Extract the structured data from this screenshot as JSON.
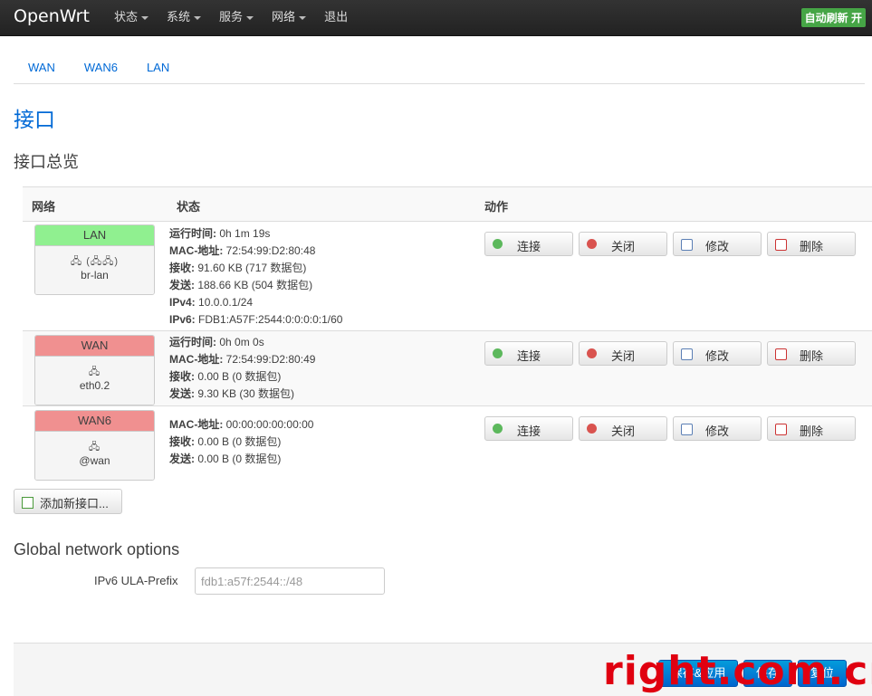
{
  "brand": "OpenWrt",
  "menu": [
    "状态",
    "系统",
    "服务",
    "网络",
    "退出"
  ],
  "menu_has_caret": [
    true,
    true,
    true,
    true,
    false
  ],
  "autorefresh": "自动刷新 开",
  "tabs": [
    "WAN",
    "WAN6",
    "LAN"
  ],
  "page_title": "接口",
  "section_title": "接口总览",
  "table": {
    "col_network": "网络",
    "col_status": "状态",
    "col_actions": "动作"
  },
  "actions": {
    "connect": "连接",
    "stop": "关闭",
    "edit": "修改",
    "delete": "删除"
  },
  "interfaces": [
    {
      "name": "LAN",
      "color": "#90f090",
      "icons": "🖧 (🖧🖧)",
      "device": "br-lan",
      "status": [
        {
          "k": "运行时间:",
          "v": " 0h 1m 19s"
        },
        {
          "k": "MAC-地址:",
          "v": " 72:54:99:D2:80:48"
        },
        {
          "k": "接收:",
          "v": " 91.60 KB (717 数据包)"
        },
        {
          "k": "发送:",
          "v": " 188.66 KB (504 数据包)"
        },
        {
          "k": "IPv4:",
          "v": " 10.0.0.1/24"
        },
        {
          "k": "IPv6:",
          "v": " FDB1:A57F:2544:0:0:0:0:1/60"
        }
      ]
    },
    {
      "name": "WAN",
      "color": "#f09090",
      "icons": "🖧",
      "device": "eth0.2",
      "status": [
        {
          "k": "运行时间:",
          "v": " 0h 0m 0s"
        },
        {
          "k": "MAC-地址:",
          "v": " 72:54:99:D2:80:49"
        },
        {
          "k": "接收:",
          "v": " 0.00 B (0 数据包)"
        },
        {
          "k": "发送:",
          "v": " 9.30 KB (30 数据包)"
        }
      ]
    },
    {
      "name": "WAN6",
      "color": "#f09090",
      "icons": "🖧",
      "device": "@wan",
      "status": [
        {
          "k": "MAC-地址:",
          "v": " 00:00:00:00:00:00"
        },
        {
          "k": "接收:",
          "v": " 0.00 B (0 数据包)"
        },
        {
          "k": "发送:",
          "v": " 0.00 B (0 数据包)"
        }
      ]
    }
  ],
  "add_interface": "添加新接口...",
  "global_title": "Global network options",
  "ula_label": "IPv6 ULA-Prefix",
  "ula_value": "fdb1:a57f:2544::/48",
  "footer_buttons": [
    "保存&应用",
    "保存",
    "复位"
  ],
  "watermark": "right.com.cn"
}
